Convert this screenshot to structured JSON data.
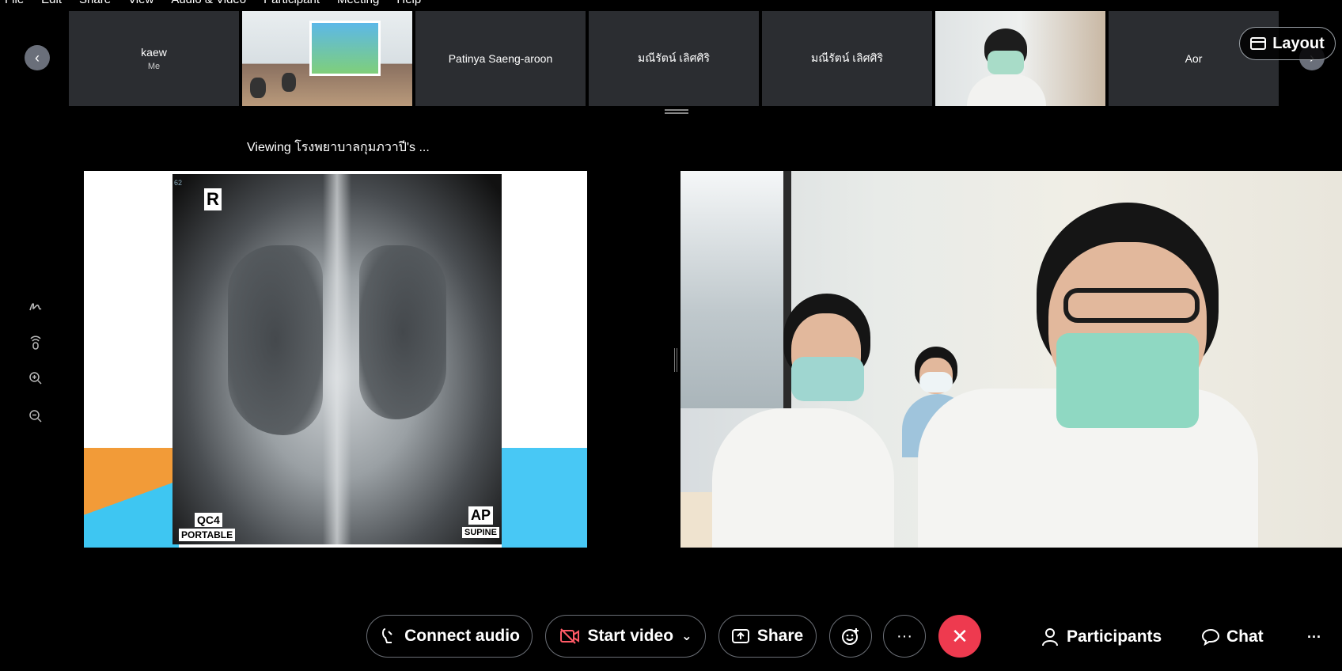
{
  "menu": [
    "File",
    "Edit",
    "Share",
    "View",
    "Audio & Video",
    "Participant",
    "Meeting",
    "Help"
  ],
  "participants": [
    {
      "name": "kaew",
      "sub": "Me",
      "video": false
    },
    {
      "name": "",
      "sub": "",
      "video": true
    },
    {
      "name": "Patinya Saeng-aroon",
      "sub": "",
      "video": false
    },
    {
      "name": "มณีรัตน์ เลิศศิริ",
      "sub": "",
      "video": false
    },
    {
      "name": "มณีรัตน์ เลิศศิริ",
      "sub": "",
      "video": false
    },
    {
      "name": "",
      "sub": "",
      "video": true
    },
    {
      "name": "Aor",
      "sub": "",
      "video": false
    }
  ],
  "layout_label": "Layout",
  "viewing_label": "Viewing โรงพยาบาลกุมภวาปี's ...",
  "xray": {
    "marker_r": "R",
    "corner_num": "62",
    "label_qc": "QC4",
    "label_portable": "PORTABLE",
    "label_ap": "AP",
    "label_supine": "SUPINE"
  },
  "toolbar": {
    "connect_audio": "Connect audio",
    "start_video": "Start video",
    "share": "Share",
    "participants": "Participants",
    "chat": "Chat"
  },
  "icons": {
    "prev": "‹",
    "next": "›",
    "more": "···",
    "end": "✕",
    "reaction": "☺",
    "chevron": "⌄"
  },
  "colors": {
    "end_call": "#ee3a4f",
    "tile_bg": "#2b2d31"
  }
}
